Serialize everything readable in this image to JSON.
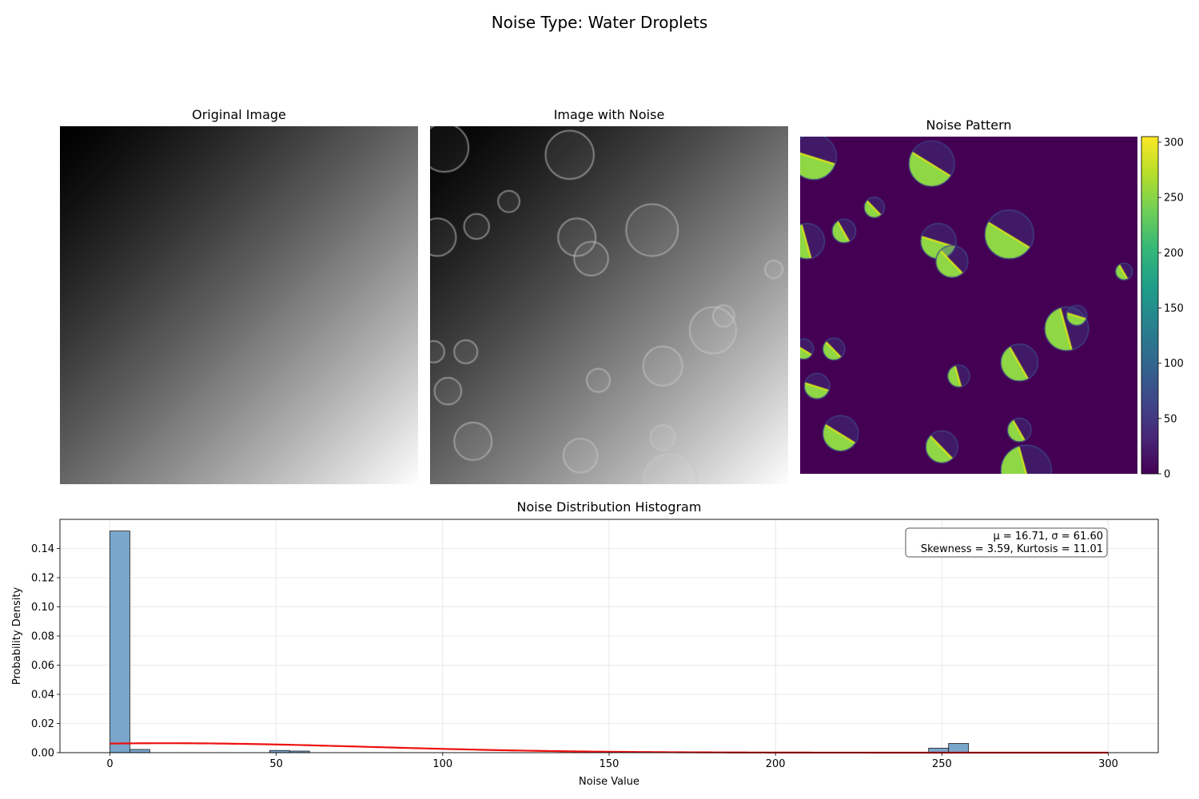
{
  "suptitle": "Noise Type: Water Droplets",
  "panels": {
    "original": {
      "title": "Original Image"
    },
    "noisy": {
      "title": "Image with Noise"
    },
    "pattern": {
      "title": "Noise Pattern",
      "colormap": "viridis"
    }
  },
  "droplets": [
    [
      0.04,
      0.06,
      0.135
    ],
    [
      0.39,
      0.08,
      0.135
    ],
    [
      0.22,
      0.21,
      0.06
    ],
    [
      0.13,
      0.28,
      0.07
    ],
    [
      0.02,
      0.31,
      0.105
    ],
    [
      0.41,
      0.31,
      0.105
    ],
    [
      0.62,
      0.29,
      0.145
    ],
    [
      0.45,
      0.37,
      0.095
    ],
    [
      0.96,
      0.4,
      0.05
    ],
    [
      0.79,
      0.57,
      0.13
    ],
    [
      0.82,
      0.53,
      0.06
    ],
    [
      0.01,
      0.63,
      0.06
    ],
    [
      0.1,
      0.63,
      0.065
    ],
    [
      0.65,
      0.67,
      0.11
    ],
    [
      0.47,
      0.71,
      0.065
    ],
    [
      0.05,
      0.74,
      0.075
    ],
    [
      0.12,
      0.88,
      0.105
    ],
    [
      0.42,
      0.92,
      0.095
    ],
    [
      0.65,
      0.87,
      0.07
    ],
    [
      0.67,
      0.99,
      0.15
    ]
  ],
  "colorbar": {
    "ticks": [
      0,
      50,
      100,
      150,
      200,
      250,
      300
    ],
    "vmin": 0,
    "vmax": 305
  },
  "chart_data": {
    "type": "bar",
    "title": "Noise Distribution Histogram",
    "xlabel": "Noise Value",
    "ylabel": "Probability Density",
    "xlim": [
      -15,
      315
    ],
    "ylim": [
      0,
      0.16
    ],
    "xticks": [
      0,
      50,
      100,
      150,
      200,
      250,
      300
    ],
    "yticks": [
      0.0,
      0.02,
      0.04,
      0.06,
      0.08,
      0.1,
      0.12,
      0.14
    ],
    "bin_width": 6,
    "bins": [
      {
        "x0": 0,
        "value": 0.152
      },
      {
        "x0": 6,
        "value": 0.0022
      },
      {
        "x0": 48,
        "value": 0.0015
      },
      {
        "x0": 54,
        "value": 0.0011
      },
      {
        "x0": 246,
        "value": 0.0031
      },
      {
        "x0": 252,
        "value": 0.0063
      }
    ],
    "fit_curve": {
      "type": "gaussian",
      "mean": 16.71,
      "std": 61.6,
      "x_range": [
        0,
        300
      ],
      "color": "#ee1111"
    },
    "stats": [
      "μ = 16.71, σ = 61.60",
      "Skewness = 3.59, Kurtosis = 11.01"
    ],
    "grid": true,
    "bar_color": "#7aa6cb"
  }
}
